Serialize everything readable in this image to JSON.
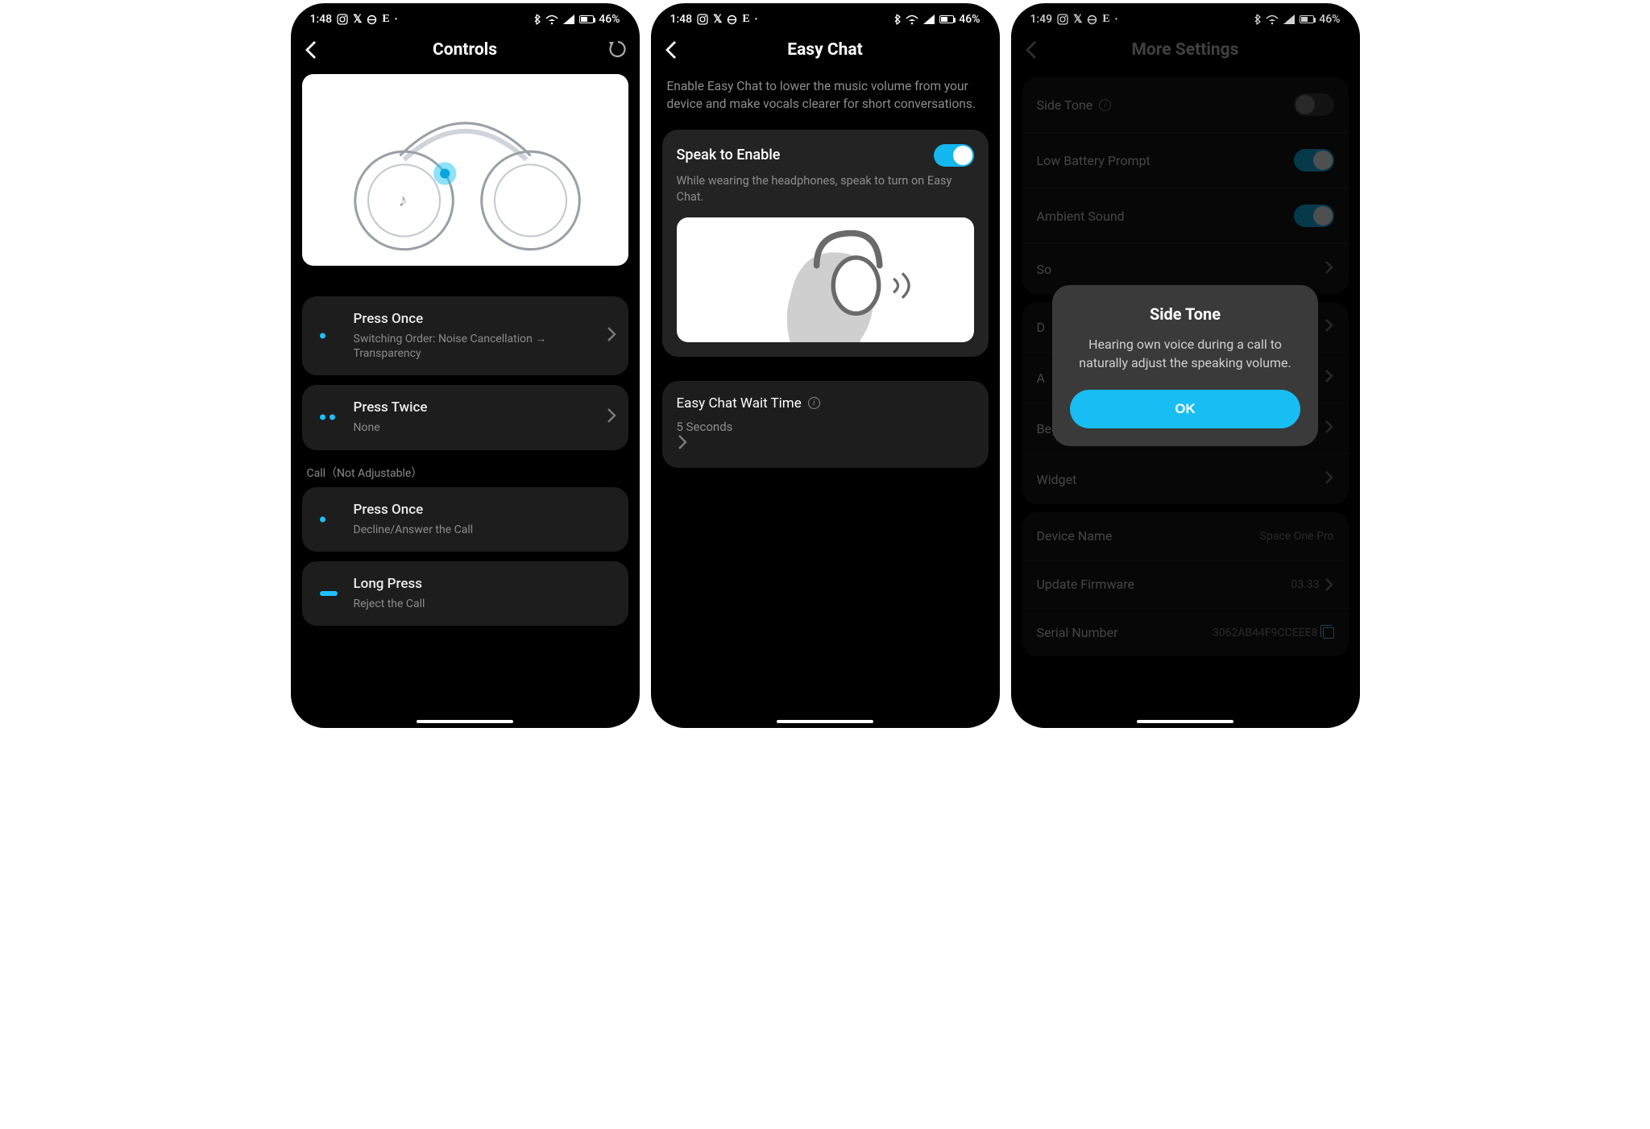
{
  "colors": {
    "accent": "#18bef3"
  },
  "statusbar": {
    "s1": {
      "time": "1:48",
      "icons": [
        "instagram",
        "x-logo",
        "circle",
        "E"
      ],
      "battery_pct": "46%"
    },
    "s2": {
      "time": "1:48",
      "icons": [
        "instagram",
        "x-logo",
        "circle",
        "E"
      ],
      "battery_pct": "46%"
    },
    "s3": {
      "time": "1:49",
      "icons": [
        "instagram",
        "x-logo",
        "circle",
        "E"
      ],
      "battery_pct": "46%"
    }
  },
  "screen1": {
    "title": "Controls",
    "press_once": {
      "title": "Press Once",
      "sub": "Switching Order: Noise Cancellation → Transparency"
    },
    "press_twice": {
      "title": "Press Twice",
      "sub": "None"
    },
    "call_section": "Call（Not Adjustable）",
    "call_press_once": {
      "title": "Press Once",
      "sub": "Decline/Answer the Call"
    },
    "long_press": {
      "title": "Long Press",
      "sub": "Reject the Call"
    }
  },
  "screen2": {
    "title": "Easy Chat",
    "desc": "Enable Easy Chat to lower the music volume from your device and make vocals clearer for short conversations.",
    "speak": {
      "title": "Speak to Enable",
      "desc": "While wearing the headphones, speak to turn on Easy Chat.",
      "toggle_on": true
    },
    "wait": {
      "title": "Easy Chat Wait Time",
      "value": "5 Seconds"
    }
  },
  "screen3": {
    "title": "More Settings",
    "group1": [
      {
        "label": "Side Tone",
        "info": true,
        "toggle": "off"
      },
      {
        "label": "Low Battery Prompt",
        "toggle": "on"
      },
      {
        "label": "Ambient Sound",
        "toggle": "on"
      },
      {
        "label": "So",
        "chevron": true
      }
    ],
    "group2": [
      {
        "label": "D",
        "chevron": true
      },
      {
        "label": "A",
        "chevron": true
      },
      {
        "label": "Beg",
        "chevron": true
      },
      {
        "label": "Widget",
        "chevron": true
      }
    ],
    "group3": [
      {
        "label": "Device Name",
        "value": "Space One Pro"
      },
      {
        "label": "Update Firmware",
        "value": "03.33",
        "chevron": true
      },
      {
        "label": "Serial Number",
        "value": "3062AB44F9CCEEE8",
        "copy": true
      }
    ],
    "modal": {
      "title": "Side Tone",
      "body": "Hearing own voice during a call to naturally adjust the speaking volume.",
      "ok": "OK"
    }
  }
}
